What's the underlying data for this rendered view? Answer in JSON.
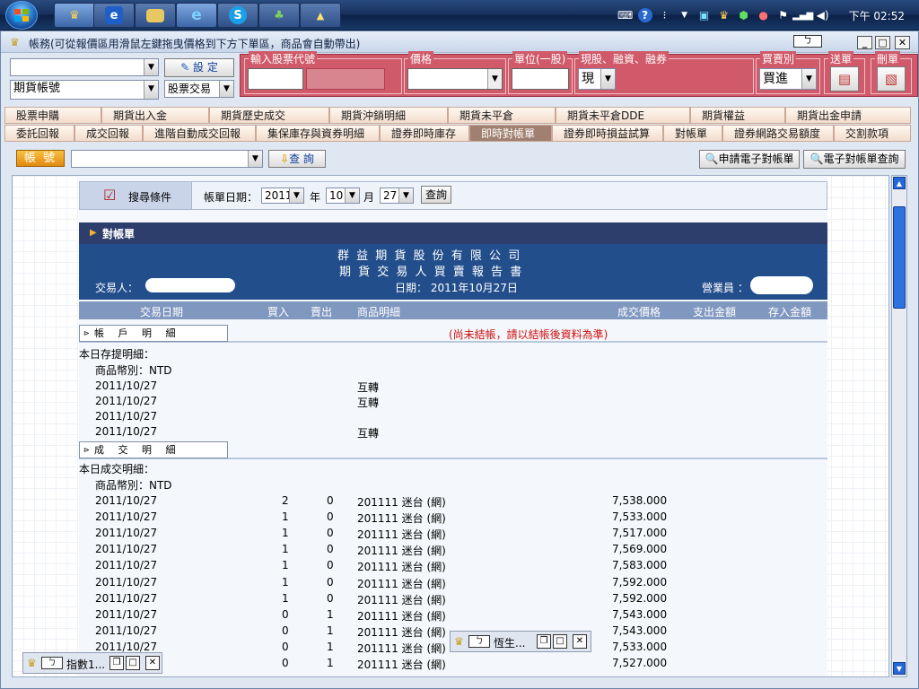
{
  "window": {
    "title": "帳務(可從報價區用滑鼠左鍵拖曳價格到下方下單區，商品會自動帶出)",
    "restore_tab": "ㄅ"
  },
  "order": {
    "account_select": "期貨帳號",
    "setting_button": "設 定",
    "trade_type": "股票交易",
    "labels": {
      "stock_code": "輸入股票代號",
      "price": "價格",
      "unit": "單位(一股)",
      "cash_margin": "現股、融資、融券",
      "side": "買賣別",
      "send": "送單",
      "delete": "刪單"
    },
    "cash_value": "現",
    "side_value": "買進"
  },
  "tabs_row1": [
    "股票申購",
    "期貨出入金",
    "期貨歷史成交",
    "期貨沖銷明細",
    "期貨未平倉",
    "期貨未平倉DDE",
    "期貨權益",
    "期貨出金申請"
  ],
  "tabs_row2": [
    "委託回報",
    "成交回報",
    "進階自動成交回報",
    "集保庫存與資券明細",
    "證券即時庫存",
    "即時對帳單",
    "證券即時損益試算",
    "對帳單",
    "證券網路交易額度",
    "交割款項"
  ],
  "subbar": {
    "account_label": "帳 號",
    "query_button": "查 詢",
    "apply_estatement": "申請電子對帳單",
    "query_estatement": "電子對帳單查詢"
  },
  "search": {
    "tab_label": "搜尋條件",
    "date_label": "帳單日期：",
    "year": "2011",
    "year_unit": "年",
    "month": "10",
    "month_unit": "月",
    "day": "27",
    "query_button": "查詢"
  },
  "report": {
    "title": "對帳單",
    "company": "群 益 期 貨 股 份 有 限 公 司",
    "doc_title": "期 貨 交 易 人 買 賣 報 告 書",
    "trader_label": "交易人：",
    "date_text": "日期：  2011年10月27日",
    "sales_label": "營業員 ：",
    "columns": [
      "交易日期",
      "買入",
      "賣出",
      "商品明細",
      "成交價格",
      "支出金額",
      "存入金額"
    ],
    "account_section": "帳 戶 明 細",
    "notice": "(尚未結帳，請以結帳後資料為準)",
    "deposit_header": "本日存提明細：",
    "currency": "商品幣別：NTD",
    "deposit_rows": [
      {
        "date": "2011/10/27",
        "desc": "互轉"
      },
      {
        "date": "2011/10/27",
        "desc": "互轉"
      },
      {
        "date": "2011/10/27",
        "desc": ""
      },
      {
        "date": "2011/10/27",
        "desc": "互轉"
      }
    ],
    "trade_section": "成 交 明 細",
    "trade_header": "本日成交明細：",
    "trade_currency": "商品幣別：NTD",
    "trades": [
      {
        "date": "2011/10/27",
        "buy": "2",
        "sell": "0",
        "product": "201111 迷台 (網)",
        "price": "7,538.000"
      },
      {
        "date": "2011/10/27",
        "buy": "1",
        "sell": "0",
        "product": "201111 迷台 (網)",
        "price": "7,533.000"
      },
      {
        "date": "2011/10/27",
        "buy": "1",
        "sell": "0",
        "product": "201111 迷台 (網)",
        "price": "7,517.000"
      },
      {
        "date": "2011/10/27",
        "buy": "1",
        "sell": "0",
        "product": "201111 迷台 (網)",
        "price": "7,569.000"
      },
      {
        "date": "2011/10/27",
        "buy": "1",
        "sell": "0",
        "product": "201111 迷台 (網)",
        "price": "7,583.000"
      },
      {
        "date": "2011/10/27",
        "buy": "1",
        "sell": "0",
        "product": "201111 迷台 (網)",
        "price": "7,592.000"
      },
      {
        "date": "2011/10/27",
        "buy": "1",
        "sell": "0",
        "product": "201111 迷台 (網)",
        "price": "7,592.000"
      },
      {
        "date": "2011/10/27",
        "buy": "0",
        "sell": "1",
        "product": "201111 迷台 (網)",
        "price": "7,543.000"
      },
      {
        "date": "2011/10/27",
        "buy": "0",
        "sell": "1",
        "product": "201111 迷台 (網)",
        "price": "7,543.000"
      },
      {
        "date": "2011/10/27",
        "buy": "0",
        "sell": "1",
        "product": "201111 迷台 (網)",
        "price": "7,533.000"
      },
      {
        "date": "2011/10/27",
        "buy": "0",
        "sell": "1",
        "product": "201111 迷台 (網)",
        "price": "7,527.000"
      }
    ]
  },
  "floating": {
    "index_window": "指數1...",
    "hangseng_window": "恆生..."
  },
  "taskbar": {
    "clock": "下午 02:52"
  }
}
